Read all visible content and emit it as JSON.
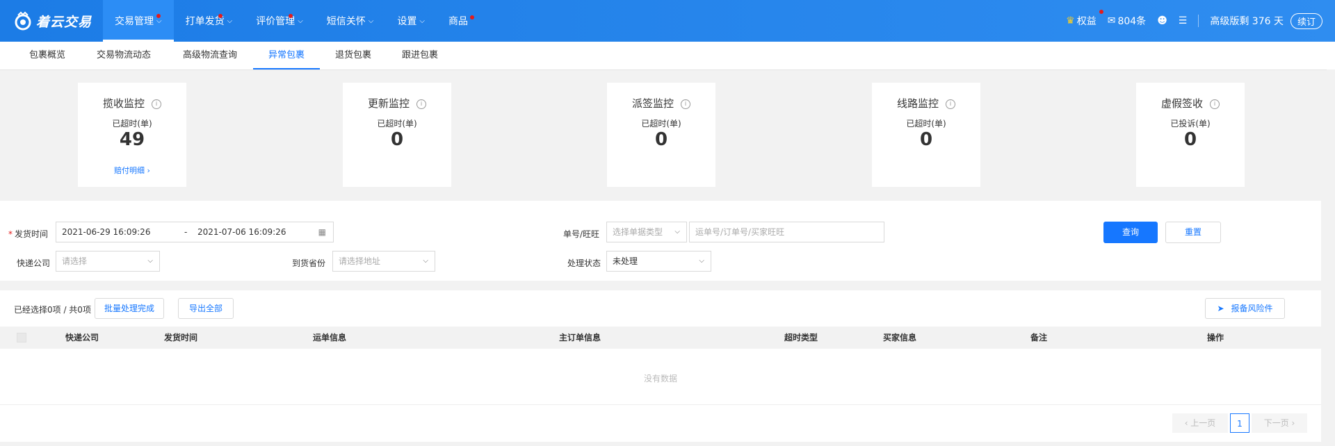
{
  "brand": {
    "logo_text": "着云交易"
  },
  "nav": [
    {
      "label": "交易管理",
      "caret": true,
      "dot": true,
      "active": true
    },
    {
      "label": "打单发货",
      "caret": true,
      "dot": true,
      "active": false
    },
    {
      "label": "评价管理",
      "caret": true,
      "dot": true,
      "active": false
    },
    {
      "label": "短信关怀",
      "caret": true,
      "dot": false,
      "active": false
    },
    {
      "label": "设置",
      "caret": true,
      "dot": false,
      "active": false
    },
    {
      "label": "商品",
      "caret": false,
      "dot": true,
      "active": false
    }
  ],
  "top_right": {
    "rights_label": "权益",
    "mail_count": "804条",
    "plan_text": "高级版剩 376 天",
    "renew_label": "续订"
  },
  "subnav": [
    "包裹概览",
    "交易物流动态",
    "高级物流查询",
    "异常包裹",
    "退货包裹",
    "跟进包裹"
  ],
  "subnav_active": 3,
  "cards": [
    {
      "title": "揽收监控",
      "sub": "已超时(单)",
      "value": "49",
      "link": "赔付明细 ›"
    },
    {
      "title": "更新监控",
      "sub": "已超时(单)",
      "value": "0",
      "link": ""
    },
    {
      "title": "派签监控",
      "sub": "已超时(单)",
      "value": "0",
      "link": ""
    },
    {
      "title": "线路监控",
      "sub": "已超时(单)",
      "value": "0",
      "link": ""
    },
    {
      "title": "虚假签收",
      "sub": "已投诉(单)",
      "value": "0",
      "link": ""
    }
  ],
  "filter": {
    "ship_time_label": "发货时间",
    "start_date": "2021-06-29 16:09:26",
    "range_sep": "-",
    "end_date": "2021-07-06 16:09:26",
    "order_label": "单号/旺旺",
    "order_type_placeholder": "选择单据类型",
    "order_input_placeholder": "运单号/订单号/买家旺旺",
    "query_button": "查询",
    "reset_button": "重置",
    "courier_label": "快递公司",
    "courier_placeholder": "请选择",
    "province_label": "到货省份",
    "province_placeholder": "请选择地址",
    "status_label": "处理状态",
    "status_value": "未处理"
  },
  "table": {
    "selected_text": "已经选择0项 / 共0项",
    "batch_button": "批量处理完成",
    "export_button": "导出全部",
    "risk_button": "报备风险件",
    "columns": [
      "快递公司",
      "发货时间",
      "运单信息",
      "主订单信息",
      "超时类型",
      "买家信息",
      "备注",
      "操作"
    ],
    "empty_text": "没有数据"
  },
  "pager": {
    "prev": "‹ 上一页",
    "page": "1",
    "next": "下一页 ›"
  },
  "colors": {
    "primary": "#1677ff",
    "topbar": "#1c7ce6",
    "badge": "#e41b1b"
  }
}
